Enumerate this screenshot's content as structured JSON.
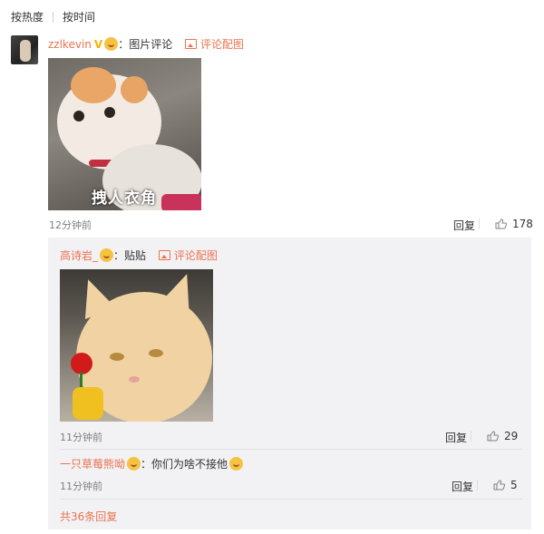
{
  "sort": {
    "hot": "按热度",
    "time": "按时间"
  },
  "comment": {
    "username": "zzlkevin",
    "badge": "V",
    "text": "：图片评论",
    "pic_link": "评论配图",
    "image_caption": "拽人衣角",
    "time": "12分钟前",
    "reply": "回复",
    "likes": "178"
  },
  "replies": [
    {
      "username": "高诗岩_",
      "text": "：贴贴",
      "pic_link": "评论配图",
      "time": "11分钟前",
      "reply": "回复",
      "likes": "29"
    },
    {
      "username": "一只草莓熊呦",
      "text": "：你们为啥不接他",
      "time": "11分钟前",
      "reply": "回复",
      "likes": "5"
    }
  ],
  "total_replies": "共36条回复",
  "colors": {
    "link": "#eb7350",
    "reply_bg": "#f2f2f5",
    "badge": "#f7b500"
  }
}
